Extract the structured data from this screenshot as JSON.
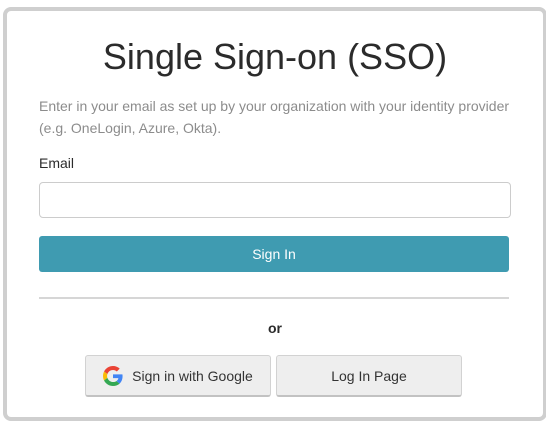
{
  "sso": {
    "title": "Single Sign-on (SSO)",
    "description": "Enter in your email as set up by your organization with your identity provider (e.g. OneLogin, Azure, Okta).",
    "email_label": "Email",
    "email_value": "",
    "sign_in_label": "Sign In",
    "or_label": "or",
    "google_label": "Sign in with Google",
    "login_page_label": "Log In Page"
  },
  "colors": {
    "primary_button": "#3f9bb1",
    "secondary_button": "#eeeeee",
    "card_border": "#cfcfcf"
  },
  "icons": {
    "google": "google-icon"
  }
}
